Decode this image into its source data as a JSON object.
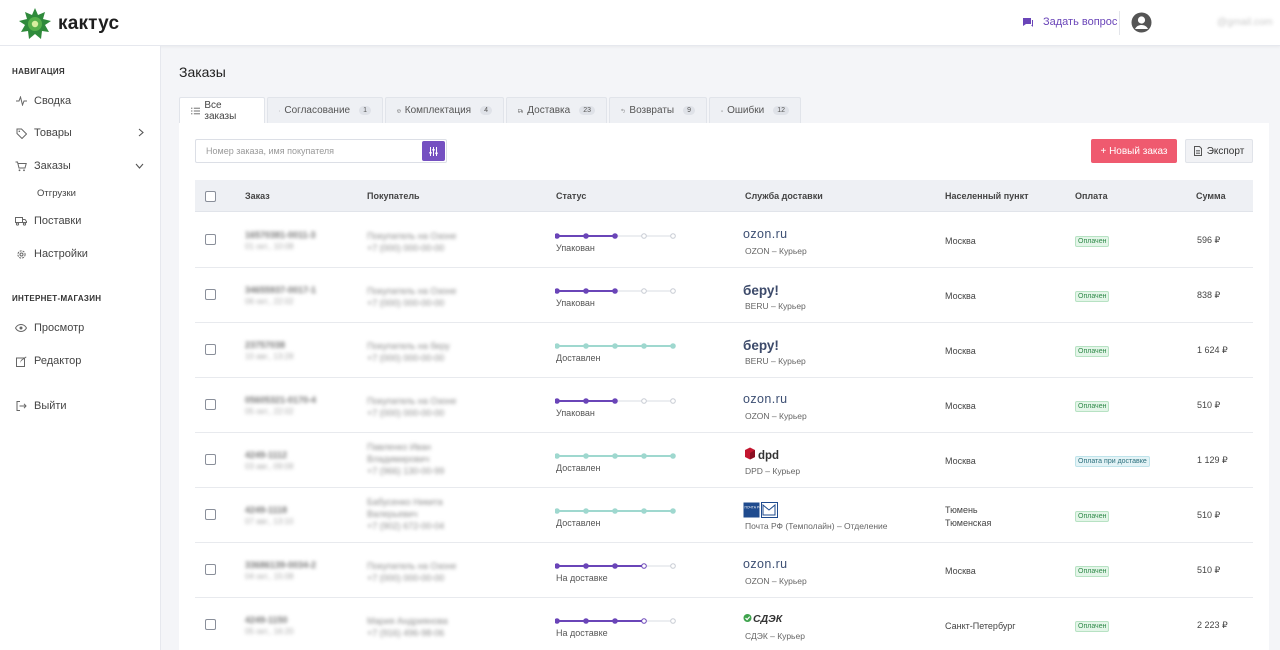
{
  "header": {
    "logo_text": "кактус",
    "ask_label": "Задать вопрос",
    "email": "@gmail.com"
  },
  "sidebar": {
    "section_nav": "НАВИГАЦИЯ",
    "items": [
      {
        "label": "Сводка",
        "icon": "activity-icon"
      },
      {
        "label": "Товары",
        "icon": "tag-icon"
      },
      {
        "label": "Заказы",
        "icon": "cart-icon"
      },
      {
        "label": "Поставки",
        "icon": "truck-icon"
      },
      {
        "label": "Настройки",
        "icon": "gear-icon"
      }
    ],
    "sub_item": "Отгрузки",
    "section_shop": "ИНТЕРНЕТ-МАГАЗИН",
    "shop_items": [
      {
        "label": "Просмотр",
        "icon": "eye-icon"
      },
      {
        "label": "Редактор",
        "icon": "edit-icon"
      }
    ],
    "logout": "Выйти"
  },
  "page": {
    "title": "Заказы"
  },
  "tabs": [
    {
      "label": "Все заказы",
      "count": "",
      "icon": "list-icon"
    },
    {
      "label": "Согласование",
      "count": "1",
      "icon": "phone-icon"
    },
    {
      "label": "Комплектация",
      "count": "4",
      "icon": "box-icon"
    },
    {
      "label": "Доставка",
      "count": "23",
      "icon": "truck-icon"
    },
    {
      "label": "Возвраты",
      "count": "9",
      "icon": "return-icon"
    },
    {
      "label": "Ошибки",
      "count": "12",
      "icon": "bell-icon"
    }
  ],
  "toolbar": {
    "search_placeholder": "Номер заказа, имя покупателя",
    "new_order": "+ Новый заказ",
    "export": "Экспорт"
  },
  "table": {
    "headers": {
      "order": "Заказ",
      "buyer": "Покупатель",
      "status": "Статус",
      "delivery": "Служба доставки",
      "city": "Населенный пункт",
      "payment": "Оплата",
      "sum": "Сумма"
    },
    "rows": [
      {
        "id": "16570381-0011-3",
        "date": "01 окт., 10:08",
        "buyer": "Покупатель на Озоне",
        "phone": "+7 (000) 000-00-00",
        "status": "Упакован",
        "progress_steps": 3,
        "track_style": "active",
        "carrier": "ozon",
        "carrier_text": "ozon.ru",
        "service": "OZON – Курьер",
        "city": "Москва",
        "city2": "",
        "payment": "Оплачен",
        "sum": "596 ₽"
      },
      {
        "id": "34655937-0017-1",
        "date": "06 окт., 22:02",
        "buyer": "Покупатель на Озоне",
        "phone": "+7 (000) 000-00-00",
        "status": "Упакован",
        "progress_steps": 3,
        "track_style": "active",
        "carrier": "beru",
        "carrier_text": "беру!",
        "service": "BERU – Курьер",
        "city": "Москва",
        "city2": "",
        "payment": "Оплачен",
        "sum": "838 ₽"
      },
      {
        "id": "23757038",
        "date": "10 авг., 13:28",
        "buyer": "Покупатель на беру",
        "phone": "+7 (000) 000-00-00",
        "status": "Доставлен",
        "progress_steps": 5,
        "track_style": "done",
        "carrier": "beru",
        "carrier_text": "беру!",
        "service": "BERU – Курьер",
        "city": "Москва",
        "city2": "",
        "payment": "Оплачен",
        "sum": "1 624 ₽"
      },
      {
        "id": "05605321-0170-4",
        "date": "05 окт., 22:02",
        "buyer": "Покупатель на Озоне",
        "phone": "+7 (000) 000-00-00",
        "status": "Упакован",
        "progress_steps": 3,
        "track_style": "active",
        "carrier": "ozon",
        "carrier_text": "ozon.ru",
        "service": "OZON – Курьер",
        "city": "Москва",
        "city2": "",
        "payment": "Оплачен",
        "sum": "510 ₽"
      },
      {
        "id": "4249-1112",
        "date": "03 авг., 09:08",
        "buyer": "Павленко Иван",
        "buyer2": "Владимирович",
        "phone": "+7 (966) 130-00-99",
        "status": "Доставлен",
        "progress_steps": 5,
        "track_style": "done",
        "carrier": "dpd",
        "carrier_text": "dpd",
        "service": "DPD – Курьер",
        "city": "Москва",
        "city2": "",
        "payment": "Оплата при доставке",
        "sum": "1 129 ₽"
      },
      {
        "id": "4249-1118",
        "date": "07 авг., 13:10",
        "buyer": "Бабусенко Никита",
        "buyer2": "Валерьевич",
        "phone": "+7 (902) 672-00-04",
        "status": "Доставлен",
        "progress_steps": 5,
        "track_style": "done",
        "carrier": "pochta",
        "carrier_text": "ПОЧТА РОССИИ",
        "service": "Почта РФ (Темполайн) – Отделение",
        "city": "Тюмень",
        "city2": "Тюменская",
        "payment": "Оплачен",
        "sum": "510 ₽"
      },
      {
        "id": "33686139-0034-2",
        "date": "04 окт., 15:08",
        "buyer": "Покупатель на Озоне",
        "phone": "+7 (000) 000-00-00",
        "status": "На доставке",
        "progress_steps": 4,
        "track_style": "active",
        "carrier": "ozon",
        "carrier_text": "ozon.ru",
        "service": "OZON – Курьер",
        "city": "Москва",
        "city2": "",
        "payment": "Оплачен",
        "sum": "510 ₽"
      },
      {
        "id": "4249-1150",
        "date": "05 окт., 16:20",
        "buyer": "Мария Андриянова",
        "phone": "+7 (916) 496-98-06",
        "status": "На доставке",
        "progress_steps": 4,
        "track_style": "active",
        "carrier": "cdek",
        "carrier_text": "СДЭК",
        "service": "СДЭК – Курьер",
        "city": "Санкт-Петербург",
        "city2": "",
        "payment": "Оплачен",
        "sum": "2 223 ₽"
      }
    ]
  },
  "colors": {
    "accent": "#6a45b8",
    "track_done": "#9fd8cf",
    "new_button": "#ef5a6f",
    "paid_bg": "#e3f5e8"
  }
}
